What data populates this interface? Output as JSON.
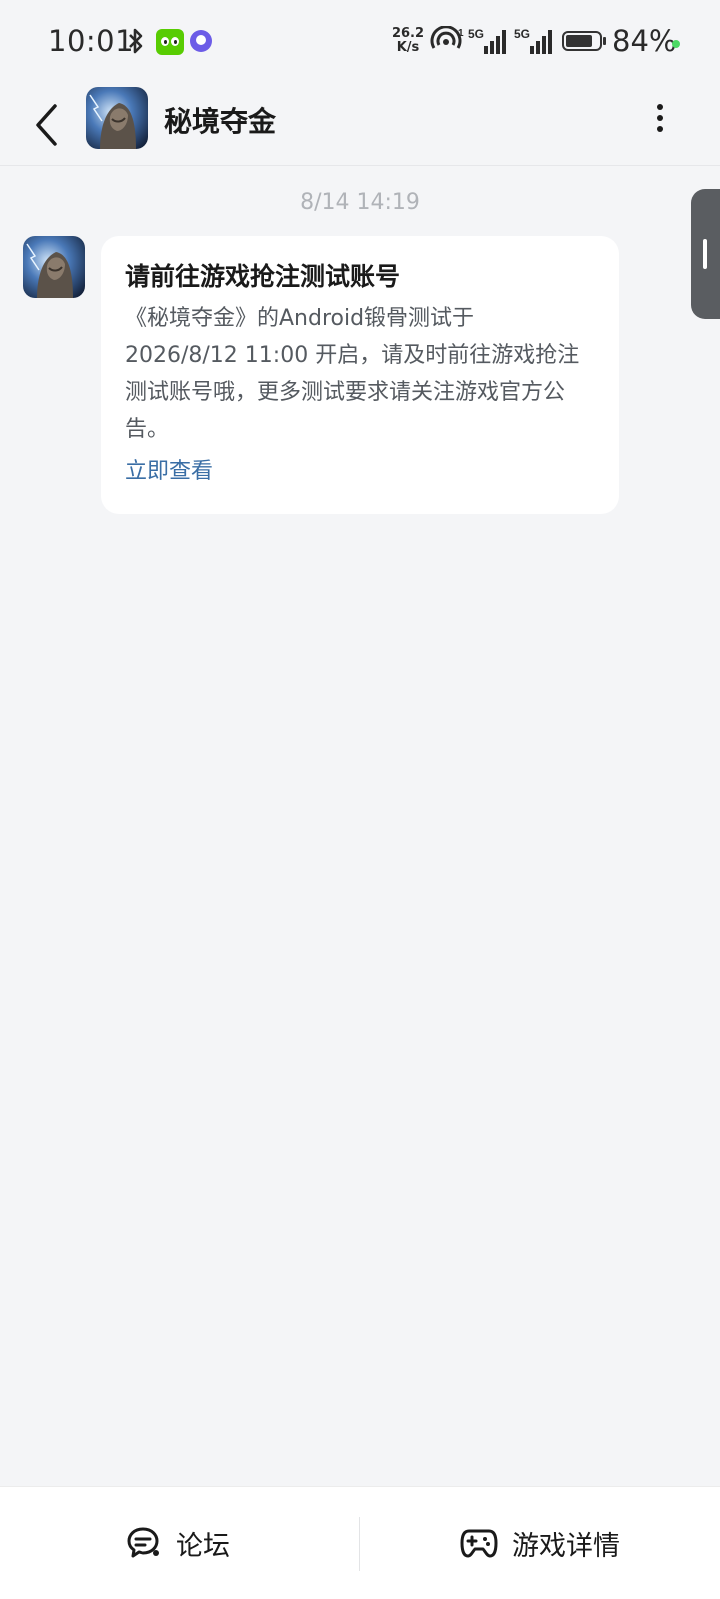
{
  "status_bar": {
    "time": "10:01",
    "net_speed_value": "26.2",
    "net_speed_unit": "K/s",
    "signal1_label": "5G",
    "signal2_label": "5G",
    "battery_percent": "84%",
    "battery_level": 0.84
  },
  "header": {
    "title": "秘境夺金"
  },
  "chat": {
    "timestamp": "8/14  14:19",
    "message": {
      "title": "请前往游戏抢注测试账号",
      "body_lines": [
        "《秘境夺金》的Android锻骨测试于",
        "2026/8/12 11:00 开启，请及时前往游戏抢注",
        "测试账号哦，更多测试要求请关注游戏官方公",
        "告。"
      ],
      "link": "立即查看"
    }
  },
  "bottom_bar": {
    "forum_label": "论坛",
    "details_label": "游戏详情"
  }
}
